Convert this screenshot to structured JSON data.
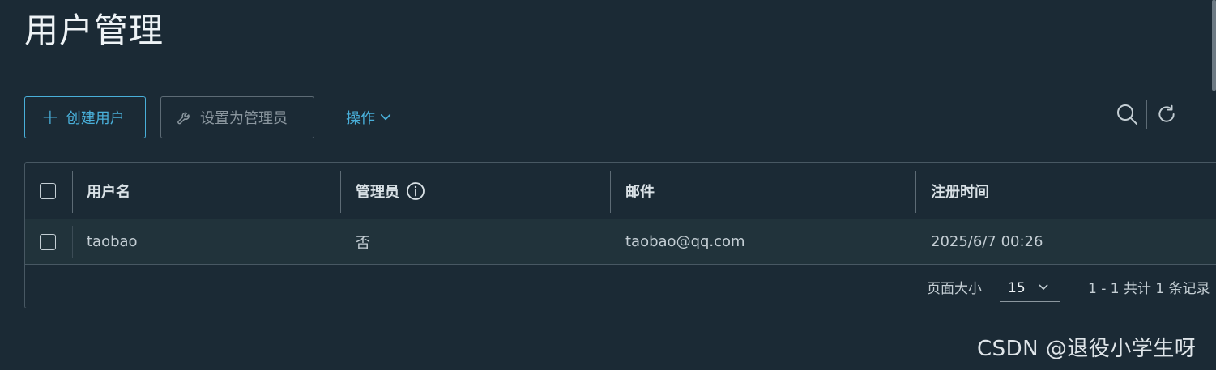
{
  "page": {
    "title": "用户管理"
  },
  "toolbar": {
    "create_label": "创建用户",
    "set_admin_label": "设置为管理员",
    "actions_label": "操作"
  },
  "grid": {
    "columns": [
      "用户名",
      "管理员",
      "邮件",
      "注册时间"
    ],
    "rows": [
      {
        "username": "taobao",
        "admin": "否",
        "email": "taobao@qq.com",
        "registered": "2025/6/7 00:26"
      }
    ],
    "footer": {
      "page_size_label": "页面大小",
      "page_size": "15",
      "summary": "1 - 1 共计 1 条记录"
    }
  },
  "watermark": "CSDN @退役小学生呀",
  "icons": {
    "create": "plus-icon",
    "set_admin": "wrench-icon",
    "actions": "chevron-down-icon",
    "search": "search-icon",
    "refresh": "refresh-icon",
    "admin_info": "info-icon"
  },
  "colors": {
    "accent": "#49afd9",
    "background": "#1b2a35",
    "row": "#21333b"
  }
}
